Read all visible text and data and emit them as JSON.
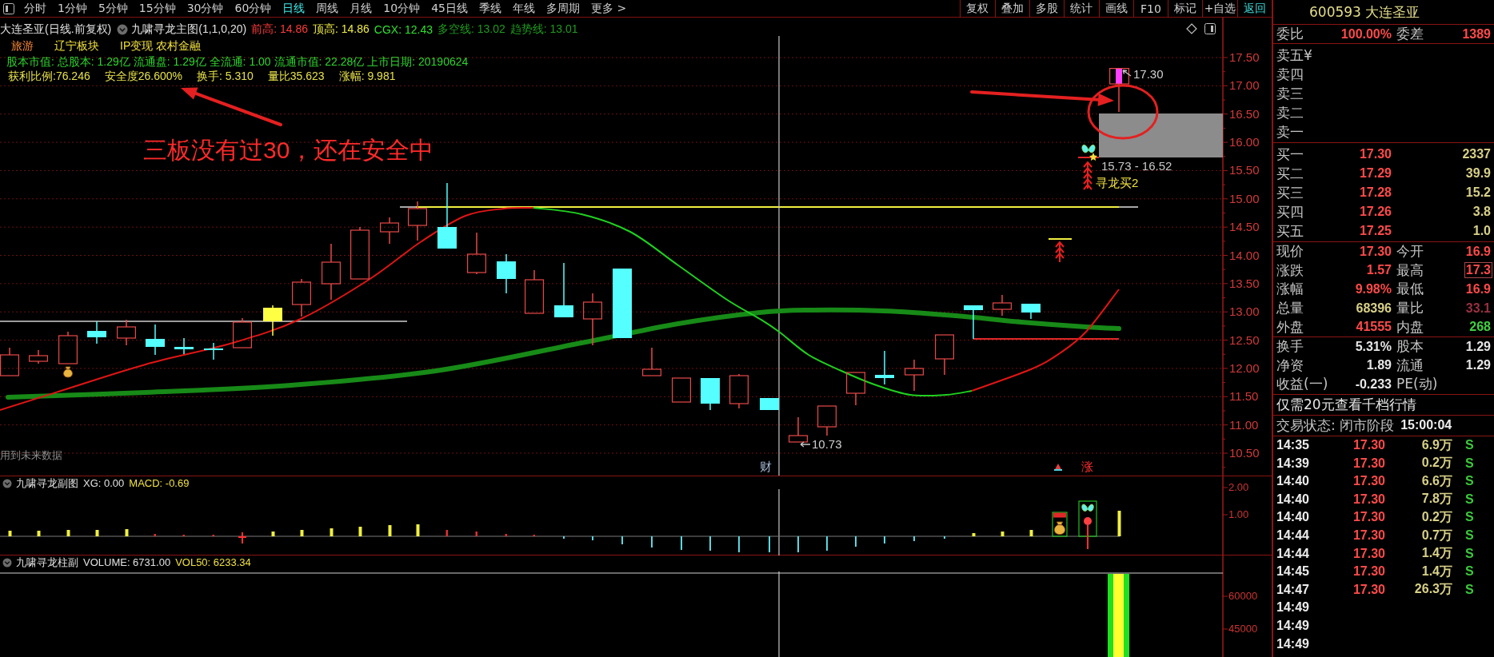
{
  "toolbar": {
    "periods": [
      {
        "label": "分时",
        "selected": false
      },
      {
        "label": "1分钟",
        "selected": false
      },
      {
        "label": "5分钟",
        "selected": false
      },
      {
        "label": "15分钟",
        "selected": false
      },
      {
        "label": "30分钟",
        "selected": false
      },
      {
        "label": "60分钟",
        "selected": false
      },
      {
        "label": "日线",
        "selected": true
      },
      {
        "label": "周线",
        "selected": false
      },
      {
        "label": "月线",
        "selected": false
      },
      {
        "label": "10分钟",
        "selected": false
      },
      {
        "label": "45日线",
        "selected": false
      },
      {
        "label": "季线",
        "selected": false
      },
      {
        "label": "年线",
        "selected": false
      },
      {
        "label": "多周期",
        "selected": false
      },
      {
        "label": "更多 >",
        "selected": false
      }
    ],
    "actions": [
      {
        "label": "复权",
        "kind": "tool"
      },
      {
        "label": "叠加",
        "kind": "tool"
      },
      {
        "label": "多股",
        "kind": "tool"
      },
      {
        "label": "统计",
        "kind": "tool"
      },
      {
        "label": "画线",
        "kind": "tool"
      },
      {
        "label": "F10",
        "kind": "tool"
      },
      {
        "label": "标记",
        "kind": "tool"
      },
      {
        "label": "+自选",
        "kind": "tool"
      },
      {
        "label": "返回",
        "kind": "nav"
      }
    ]
  },
  "chart": {
    "title": "大连圣亚(日线.前复权)",
    "indicator": "九啸寻龙主图(1,1,0,20)",
    "readouts": [
      {
        "label": "前高: 14.86",
        "color": "#ff3a3a"
      },
      {
        "label": "顶高: 14.86",
        "color": "#f0ec48"
      },
      {
        "label": "CGX: 12.43",
        "color": "#30e030"
      },
      {
        "label": "多空线: 13.02",
        "color": "#1f9a1f"
      },
      {
        "label": "趋势线: 13.01",
        "color": "#1f9a1f"
      }
    ],
    "sectors": [
      {
        "label": "旅游",
        "color": "#ff8c3a"
      },
      {
        "label": "辽宁板块",
        "color": "#f0e040"
      },
      {
        "label": "IP变现 农村金融",
        "color": "#f0e040"
      }
    ],
    "fundamentals": "股本市值: 总股本: 1.29亿 流通盘: 1.29亿 全流通: 1.00 流通市值: 22.28亿 上市日期: 20190624",
    "stats": [
      "获利比例:76.246",
      "安全度26.600%",
      "换手: 5.310",
      "量比35.623",
      "涨幅: 9.981"
    ],
    "annotation": "三板没有过30，还在安全中",
    "price_axis": [
      "17.50",
      "17.00",
      "16.50",
      "16.00",
      "15.50",
      "15.00",
      "14.50",
      "14.00",
      "13.50",
      "13.00",
      "12.50",
      "12.00",
      "11.50",
      "11.00",
      "10.50"
    ],
    "high_label": "17.30",
    "low_label": "10.73",
    "zone_label": "15.73 - 16.52",
    "signal_label": "寻龙买2",
    "footnote": "用到未来数据",
    "markers": [
      {
        "label": "财",
        "kind": "finance"
      },
      {
        "label": "涨",
        "kind": "limit"
      }
    ]
  },
  "sub_chart": {
    "kind": "histogram",
    "title": "九啸寻龙副图",
    "readouts": [
      {
        "label": "XG: 0.00",
        "color": "#e0e0e0"
      },
      {
        "label": "MACD: -0.69",
        "color": "#f0e040"
      }
    ],
    "axis": [
      "2.00",
      "1.00"
    ]
  },
  "volume_chart": {
    "kind": "volume",
    "title": "九啸寻龙柱副",
    "readouts": [
      {
        "label": "VOLUME: 6731.00",
        "color": "#e0e0e0"
      },
      {
        "label": "VOL50: 6233.34",
        "color": "#f0e040"
      }
    ],
    "axis": [
      "60000",
      "45000"
    ]
  },
  "quote": {
    "title": "600593 大连圣亚",
    "order": [
      {
        "label": "委比",
        "value": "100.00%"
      },
      {
        "label": "委差",
        "value": "1389"
      }
    ],
    "asks": [
      "卖五¥",
      "卖四",
      "卖三",
      "卖二",
      "卖一"
    ],
    "bids": [
      {
        "label": "买一",
        "price": "17.30",
        "volume": "2337"
      },
      {
        "label": "买二",
        "price": "17.29",
        "volume": "39.9"
      },
      {
        "label": "买三",
        "price": "17.28",
        "volume": "15.2"
      },
      {
        "label": "买四",
        "price": "17.26",
        "volume": "3.8"
      },
      {
        "label": "买五",
        "price": "17.25",
        "volume": "1.0"
      }
    ],
    "stats": [
      {
        "label": "现价",
        "value": "17.30",
        "color": "#ff4a4a",
        "highlighted": false
      },
      {
        "label": "今开",
        "value": "16.9",
        "color": "#ff4a4a",
        "highlighted": false
      },
      {
        "label": "涨跌",
        "value": "1.57",
        "color": "#ff4a4a",
        "highlighted": false
      },
      {
        "label": "最高",
        "value": "17.3",
        "color": "#ff4a4a",
        "highlighted": true
      },
      {
        "label": "涨幅",
        "value": "9.98%",
        "color": "#ff4a4a",
        "highlighted": false
      },
      {
        "label": "最低",
        "value": "16.9",
        "color": "#ff4a4a",
        "highlighted": false
      },
      {
        "label": "总量",
        "value": "68396",
        "color": "#d8d088",
        "highlighted": false
      },
      {
        "label": "量比",
        "value": "33.1",
        "color": "#9a3040",
        "highlighted": false
      },
      {
        "label": "外盘",
        "value": "41555",
        "color": "#ff4a4a",
        "highlighted": false
      },
      {
        "label": "内盘",
        "value": "268",
        "color": "#40d040",
        "highlighted": false
      }
    ],
    "ratios": [
      {
        "label": "换手",
        "value": "5.31%"
      },
      {
        "label": "股本",
        "value": "1.29"
      },
      {
        "label": "净资",
        "value": "1.89"
      },
      {
        "label": "流通",
        "value": "1.29"
      },
      {
        "label": "收益(一)",
        "value": "-0.233"
      },
      {
        "label": "PE(动)"
      }
    ],
    "notice": "仅需20元查看千档行情",
    "status": {
      "label": "交易状态: 闭市阶段",
      "time": "15:00:04"
    },
    "trades": [
      {
        "time": "14:35",
        "price": "17.30",
        "volume": "6.9万",
        "side": "S"
      },
      {
        "time": "14:39",
        "price": "17.30",
        "volume": "0.2万",
        "side": "S"
      },
      {
        "time": "14:40",
        "price": "17.30",
        "volume": "6.6万",
        "side": "S"
      },
      {
        "time": "14:40",
        "price": "17.30",
        "volume": "7.8万",
        "side": "S"
      },
      {
        "time": "14:40",
        "price": "17.30",
        "volume": "0.2万",
        "side": "S"
      },
      {
        "time": "14:44",
        "price": "17.30",
        "volume": "0.7万",
        "side": "S"
      },
      {
        "time": "14:44",
        "price": "17.30",
        "volume": "1.4万",
        "side": "S"
      },
      {
        "time": "14:45",
        "price": "17.30",
        "volume": "1.4万",
        "side": "S"
      },
      {
        "time": "14:47",
        "price": "17.30",
        "volume": "26.3万",
        "side": "S"
      },
      {
        "time": "14:49"
      },
      {
        "time": "14:49"
      },
      {
        "time": "14:49"
      }
    ]
  }
}
